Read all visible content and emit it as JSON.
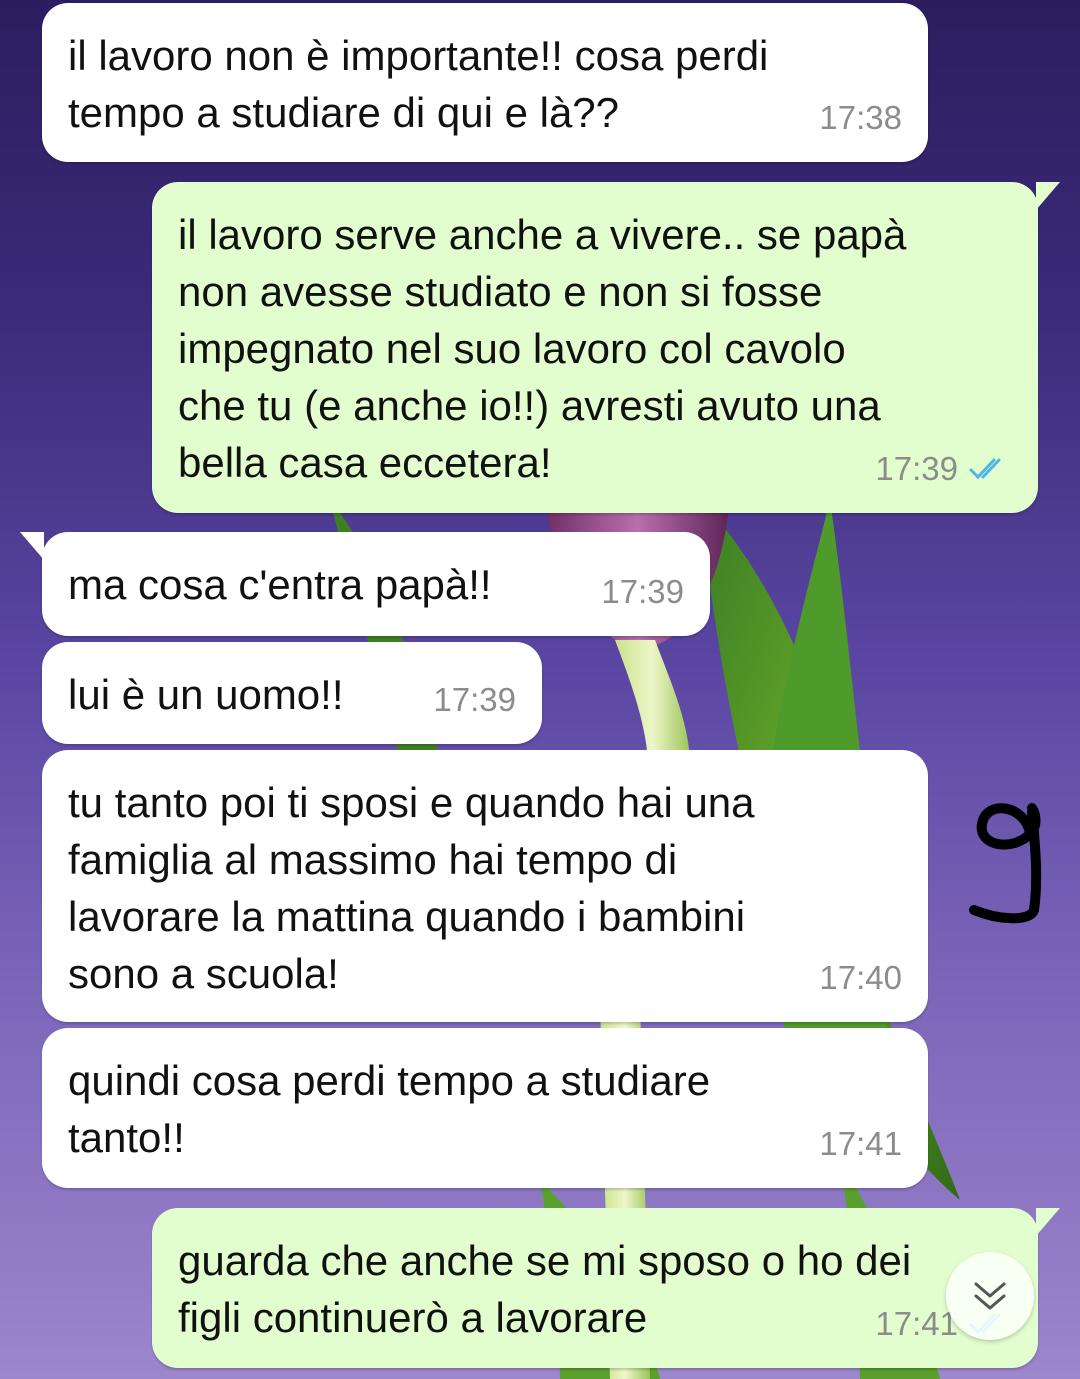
{
  "messages": [
    {
      "direction": "in",
      "text": "il lavoro non è importante!! cosa perdi\ntempo a studiare di qui e là??",
      "time": "17:38"
    },
    {
      "direction": "out",
      "text": "il lavoro serve anche a vivere.. se papà\nnon avesse studiato e non si fosse\nimpegnato nel suo lavoro col cavolo\nche tu (e anche io!!) avresti avuto una\nbella casa eccetera!",
      "time": "17:39",
      "status": "read"
    },
    {
      "direction": "in",
      "text": "ma cosa c'entra papà!!",
      "time": "17:39"
    },
    {
      "direction": "in",
      "text": "lui è un uomo!!",
      "time": "17:39"
    },
    {
      "direction": "in",
      "text": "tu tanto poi ti sposi e quando hai una\nfamiglia al massimo hai tempo di\nlavorare la mattina quando i bambini\nsono a scuola!",
      "time": "17:40"
    },
    {
      "direction": "in",
      "text": "quindi cosa perdi tempo a studiare\ntanto!!",
      "time": "17:41"
    },
    {
      "direction": "out",
      "text": "guarda che anche se mi sposo o ho dei\nfigli continuerò a lavorare",
      "time": "17:41",
      "status": "read"
    }
  ],
  "annotation": {
    "icon": "handwritten-nine"
  },
  "scroll_button": {
    "icon": "double-chevron-down-icon"
  },
  "colors": {
    "incoming_bubble": "#ffffff",
    "outgoing_bubble": "#e2fdce",
    "read_ticks": "#4fb6ec",
    "timestamp": "#8c8c8c"
  }
}
